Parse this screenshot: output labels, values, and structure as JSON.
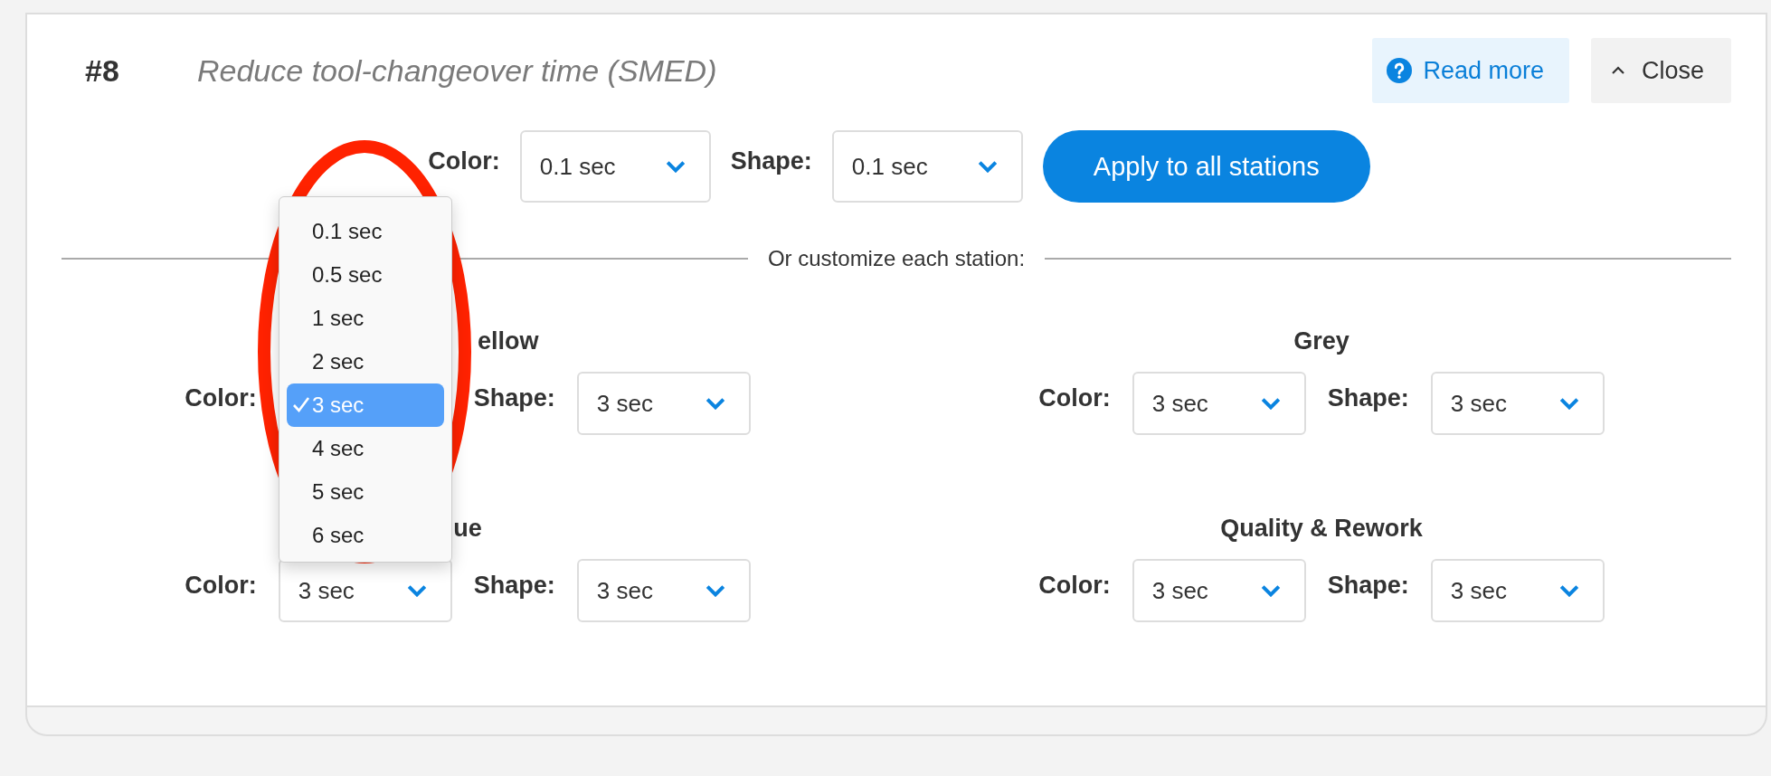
{
  "card": {
    "number": "#8",
    "title": "Reduce tool-changeover time (SMED)",
    "read_more": "Read more",
    "close": "Close"
  },
  "apply_all": {
    "color_label": "Color:",
    "color_value": "0.1 sec",
    "shape_label": "Shape:",
    "shape_value": "0.1 sec",
    "button": "Apply to all stations"
  },
  "divider": "Or customize each station:",
  "stations": [
    {
      "name": "ellow",
      "color_label": "Color:",
      "shape_label": "Shape:",
      "shape_value": "3 sec",
      "open": true
    },
    {
      "name": "Grey",
      "color_label": "Color:",
      "color_value": "3 sec",
      "shape_label": "Shape:",
      "shape_value": "3 sec",
      "open": false
    },
    {
      "name": "ue",
      "color_label": "Color:",
      "color_value": "3 sec",
      "shape_label": "Shape:",
      "shape_value": "3 sec",
      "open": false
    },
    {
      "name": "Quality & Rework",
      "color_label": "Color:",
      "color_value": "3 sec",
      "shape_label": "Shape:",
      "shape_value": "3 sec",
      "open": false
    }
  ],
  "dropdown": {
    "options": [
      {
        "label": "0.1 sec",
        "selected": false
      },
      {
        "label": "0.5 sec",
        "selected": false
      },
      {
        "label": "1 sec",
        "selected": false
      },
      {
        "label": "2 sec",
        "selected": false
      },
      {
        "label": "3 sec",
        "selected": true
      },
      {
        "label": "4 sec",
        "selected": false
      },
      {
        "label": "5 sec",
        "selected": false
      },
      {
        "label": "6 sec",
        "selected": false
      }
    ]
  }
}
